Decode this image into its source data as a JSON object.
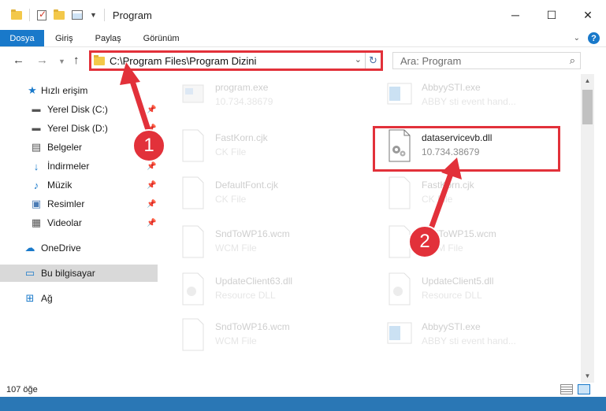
{
  "window": {
    "title": "Program"
  },
  "ribbon": {
    "tabs": [
      "Dosya",
      "Giriş",
      "Paylaş",
      "Görünüm"
    ],
    "help": "?"
  },
  "navbar": {
    "address": "C:\\Program Files\\Program Dizini",
    "search_placeholder": "Ara: Program"
  },
  "sidebar": {
    "items": [
      {
        "label": "Hızlı erişim",
        "icon": "star-icon"
      },
      {
        "label": "Yerel Disk (C:)",
        "icon": "drive-icon"
      },
      {
        "label": "Yerel Disk (D:)",
        "icon": "drive-icon"
      },
      {
        "label": "Belgeler",
        "icon": "documents-icon"
      },
      {
        "label": "İndirmeler",
        "icon": "download-arrow-icon"
      },
      {
        "label": "Müzik",
        "icon": "music-note-icon"
      },
      {
        "label": "Resimler",
        "icon": "pictures-icon"
      },
      {
        "label": "Videolar",
        "icon": "film-icon"
      },
      {
        "label": "OneDrive",
        "icon": "cloud-icon"
      },
      {
        "label": "Bu bilgisayar",
        "icon": "computer-icon"
      },
      {
        "label": "Ağ",
        "icon": "network-icon"
      }
    ]
  },
  "files": {
    "left": [
      {
        "name": "program.exe",
        "sub": "10.734.38679"
      },
      {
        "name": "FastKorn.cjk",
        "sub": "CK File"
      },
      {
        "name": "DefaultFont.cjk",
        "sub": "CK File"
      },
      {
        "name": "SndToWP16.wcm",
        "sub": "WCM File"
      },
      {
        "name": "UpdateClient63.dll",
        "sub": "Resource DLL"
      },
      {
        "name": "SndToWP16.wcm",
        "sub": "WCM File"
      }
    ],
    "right": [
      {
        "name": "AbbyySTI.exe",
        "sub": "ABBY sti event hand..."
      },
      {
        "name": "dataservicevb.dll",
        "sub": "10.734.38679"
      },
      {
        "name": "FastKorn.cjk",
        "sub": "CK File"
      },
      {
        "name": "SndToWP15.wcm",
        "sub": "WCM File"
      },
      {
        "name": "UpdateClient5.dll",
        "sub": "Resource DLL"
      },
      {
        "name": "AbbyySTI.exe",
        "sub": "ABBY sti event hand..."
      }
    ]
  },
  "status": {
    "count": "107 öğe"
  },
  "callouts": {
    "one": "1",
    "two": "2"
  },
  "colors": {
    "accent": "#1979ca",
    "highlight": "#e2313a"
  }
}
